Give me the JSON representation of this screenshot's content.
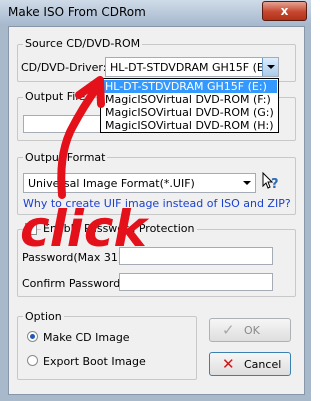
{
  "window": {
    "title": "Make ISO From CDRom",
    "close_glyph": "x"
  },
  "source": {
    "legend": "Source CD/DVD-ROM",
    "driver_label": "CD/DVD-Driver:",
    "driver_value": "HL-DT-STDVDRAM GH15F   (E",
    "options": [
      "HL-DT-STDVDRAM GH15F   (E:)",
      "MagicISOVirtual DVD-ROM  (F:)",
      "MagicISOVirtual DVD-ROM  (G:)",
      "MagicISOVirtual DVD-ROM  (H:)"
    ]
  },
  "output_file": {
    "legend": "Output File"
  },
  "output_format": {
    "legend": "Output Format",
    "value": "Universal Image Format(*.UIF)",
    "help_link": "Why to create UIF image instead of ISO and ZIP?"
  },
  "password": {
    "legend": "Enable Password Protection",
    "password_label": "Password(Max 31):",
    "confirm_label": "Confirm Password:"
  },
  "option": {
    "legend": "Option",
    "make_cd": "Make CD Image",
    "export_boot": "Export Boot Image",
    "selected": "Make CD Image"
  },
  "buttons": {
    "ok": "OK",
    "cancel": "Cancel"
  },
  "annotation": {
    "text": "click",
    "color": "#e4101a"
  }
}
